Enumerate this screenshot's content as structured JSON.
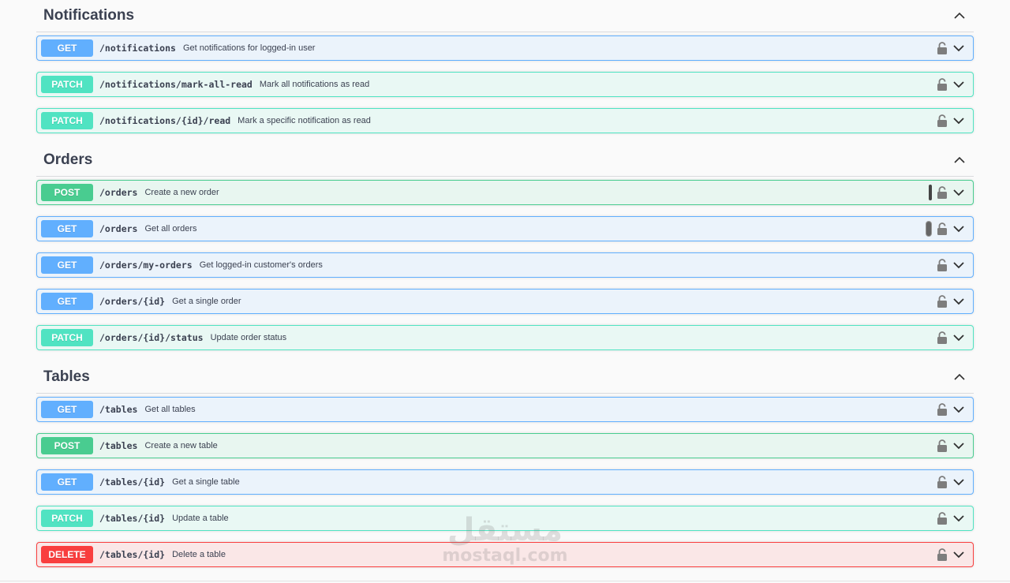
{
  "sections": [
    {
      "title": "Notifications",
      "operations": [
        {
          "method": "GET",
          "path": "/notifications",
          "summary": "Get notifications for logged-in user"
        },
        {
          "method": "PATCH",
          "path": "/notifications/mark-all-read",
          "summary": "Mark all notifications as read"
        },
        {
          "method": "PATCH",
          "path": "/notifications/{id}/read",
          "summary": "Mark a specific notification as read"
        }
      ]
    },
    {
      "title": "Orders",
      "operations": [
        {
          "method": "POST",
          "path": "/orders",
          "summary": "Create a new order"
        },
        {
          "method": "GET",
          "path": "/orders",
          "summary": "Get all orders"
        },
        {
          "method": "GET",
          "path": "/orders/my-orders",
          "summary": "Get logged-in customer's orders"
        },
        {
          "method": "GET",
          "path": "/orders/{id}",
          "summary": "Get a single order"
        },
        {
          "method": "PATCH",
          "path": "/orders/{id}/status",
          "summary": "Update order status"
        }
      ]
    },
    {
      "title": "Tables",
      "operations": [
        {
          "method": "GET",
          "path": "/tables",
          "summary": "Get all tables"
        },
        {
          "method": "POST",
          "path": "/tables",
          "summary": "Create a new table"
        },
        {
          "method": "GET",
          "path": "/tables/{id}",
          "summary": "Get a single table"
        },
        {
          "method": "PATCH",
          "path": "/tables/{id}",
          "summary": "Update a table"
        },
        {
          "method": "DELETE",
          "path": "/tables/{id}",
          "summary": "Delete a table"
        }
      ]
    }
  ],
  "watermark": {
    "arabic": "مستقل",
    "latin": "mostaql.com"
  },
  "icons": {
    "lock": "unlocked-padlock-icon",
    "expand": "chevron-down-icon",
    "collapse": "chevron-up-icon"
  },
  "colors": {
    "get": "#61affe",
    "post": "#49cc90",
    "patch": "#50e3c2",
    "delete": "#f93e3e"
  }
}
